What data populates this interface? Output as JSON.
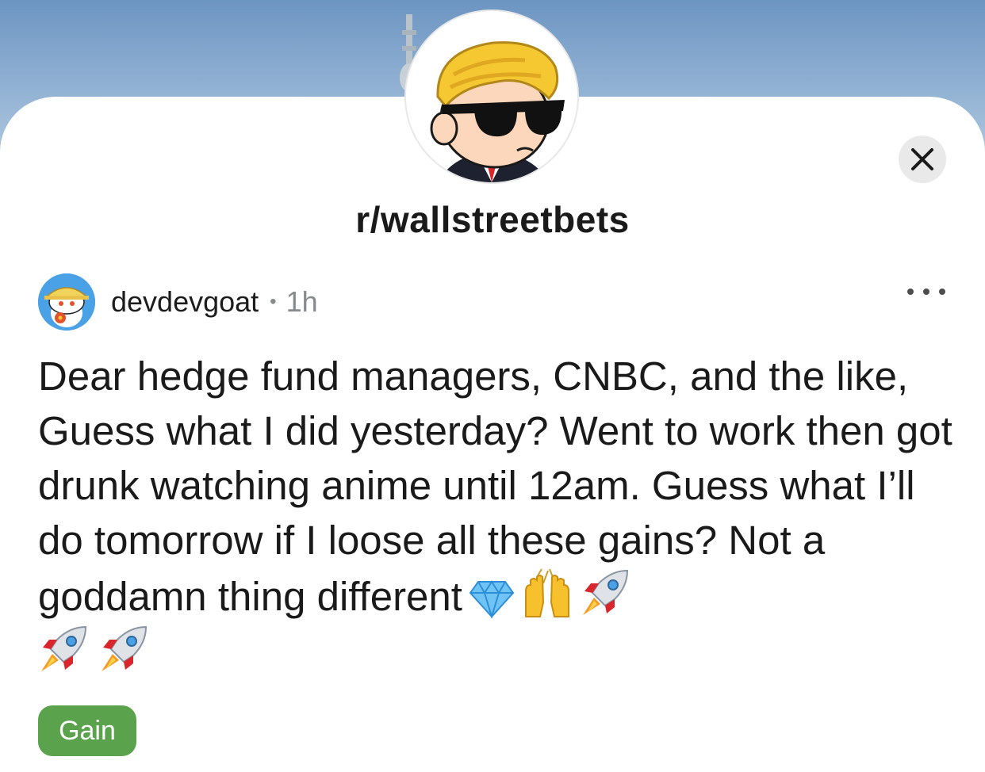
{
  "community": {
    "name": "r/wallstreetbets",
    "avatar_icon": "wsb-mascot-sunglasses-icon"
  },
  "close_icon": "close-icon",
  "post": {
    "author": "devdevgoat",
    "separator": "•",
    "age": "1h",
    "more_icon": "more-options-icon",
    "text": "Dear hedge fund managers, CNBC, and the like, Guess what I did yesterday? Went to work then got drunk watching anime until 12am. Guess what I’ll do tomorrow if I loose all these gains? Not a goddamn thing different",
    "emojis": [
      "gem-icon",
      "raising-hands-icon",
      "rocket-icon",
      "rocket-icon",
      "rocket-icon"
    ],
    "flair": "Gain",
    "flair_color": "#5aa24c"
  }
}
